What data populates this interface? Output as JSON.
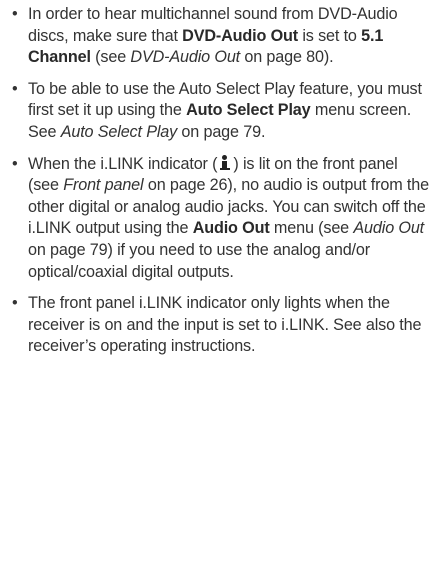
{
  "bullets": [
    {
      "t1": "In order to hear multichannel sound from DVD-Audio discs, make sure that ",
      "b1": "DVD-Audio Out",
      "t2": " is set to ",
      "b2": "5.1 Channel",
      "t3": " (see ",
      "i1": "DVD-Audio Out",
      "t4": " on page 80)."
    },
    {
      "t1": "To be able to use the Auto Select Play feature, you must first set it up using the ",
      "b1": "Auto Select Play",
      "t2": " menu screen. See ",
      "i1": "Auto Select Play",
      "t3": " on page 79."
    },
    {
      "t1": "When the i.LINK indicator (",
      "icon": "ilink-icon",
      "t2": ") is lit on the front panel (see ",
      "i1": "Front panel",
      "t3": " on page 26), no audio is output from the other digital or analog audio jacks. You can switch off the i.LINK output using the ",
      "b1": "Audio Out",
      "t4": " menu (see ",
      "i2": "Audio Out",
      "t5": " on page 79) if you need to use the analog and/or optical/coaxial digital outputs."
    },
    {
      "t1": "The front panel i.LINK indicator only lights when the receiver is on and the input is set to i.LINK. See also the receiver’s operating instructions."
    }
  ],
  "bullet_glyph": "•"
}
